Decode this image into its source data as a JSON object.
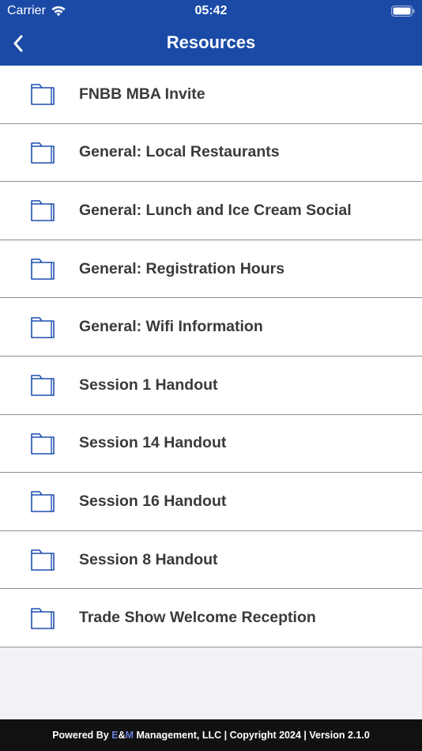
{
  "status_bar": {
    "carrier": "Carrier",
    "time": "05:42"
  },
  "nav": {
    "title": "Resources",
    "back_icon": "chevron-left-icon"
  },
  "colors": {
    "header_bg": "#1a4aa6",
    "icon_blue": "#1f4fb0",
    "footer_bg": "#111111",
    "footer_accent": "#6b7fd6"
  },
  "resources": [
    {
      "label": "FNBB MBA Invite",
      "icon": "folder-icon"
    },
    {
      "label": "General: Local Restaurants",
      "icon": "folder-icon"
    },
    {
      "label": "General: Lunch and Ice Cream Social",
      "icon": "folder-icon"
    },
    {
      "label": "General: Registration Hours",
      "icon": "folder-icon"
    },
    {
      "label": "General: Wifi Information",
      "icon": "folder-icon"
    },
    {
      "label": "Session 1 Handout",
      "icon": "folder-icon"
    },
    {
      "label": "Session 14 Handout",
      "icon": "folder-icon"
    },
    {
      "label": "Session 16 Handout",
      "icon": "folder-icon"
    },
    {
      "label": "Session 8 Handout",
      "icon": "folder-icon"
    },
    {
      "label": "Trade Show Welcome Reception",
      "icon": "folder-icon"
    }
  ],
  "footer": {
    "prefix": "Powered By ",
    "brand_e": "E",
    "brand_amp": "&",
    "brand_m": "M",
    "suffix": " Management, LLC | Copyright 2024 | Version 2.1.0"
  }
}
